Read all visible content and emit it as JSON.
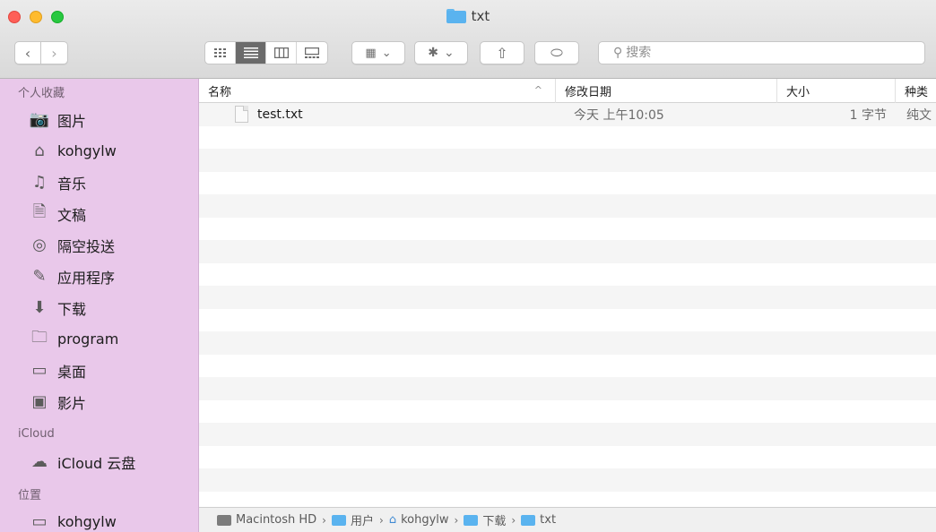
{
  "window": {
    "title": "txt"
  },
  "toolbar": {
    "back_icon": "‹",
    "forward_icon": "›",
    "view_modes": [
      "icon-view",
      "list-view",
      "column-view",
      "gallery-view"
    ],
    "arrange_icon": "▦",
    "action_icon": "✱",
    "chevron": "⌄",
    "share_icon": "⇧",
    "tag_icon": "⬭",
    "search_placeholder": "搜索",
    "search_glyph": "⚲"
  },
  "sidebar": {
    "favorites_header": "个人收藏",
    "favorites": [
      {
        "label": "图片",
        "icon": "📷"
      },
      {
        "label": "kohgylw",
        "icon": "⌂"
      },
      {
        "label": "音乐",
        "icon": "♫"
      },
      {
        "label": "文稿",
        "icon": "🗎"
      },
      {
        "label": "隔空投送",
        "icon": "◎"
      },
      {
        "label": "应用程序",
        "icon": "✎"
      },
      {
        "label": "下载",
        "icon": "⬇"
      },
      {
        "label": "program",
        "icon": "🗀"
      },
      {
        "label": "桌面",
        "icon": "▭"
      },
      {
        "label": "影片",
        "icon": "▣"
      }
    ],
    "icloud_header": "iCloud",
    "icloud": [
      {
        "label": "iCloud 云盘",
        "icon": "☁"
      }
    ],
    "locations_header": "位置",
    "locations": [
      {
        "label": "kohgylw",
        "icon": "▭"
      }
    ]
  },
  "columns": {
    "name": "名称",
    "date": "修改日期",
    "size": "大小",
    "kind": "种类",
    "sort_glyph": "^"
  },
  "files": [
    {
      "name": "test.txt",
      "date": "今天 上午10:05",
      "size": "1 字节",
      "kind": "纯文"
    }
  ],
  "pathbar": {
    "segments": [
      "Macintosh HD",
      "用户",
      "kohgylw",
      "下载",
      "txt"
    ],
    "separator": "›"
  },
  "colors": {
    "sidebar_bg": "#e9c8ea",
    "folder_blue": "#5ab3ef",
    "close": "#fe5f57",
    "minimize": "#febb2e",
    "zoom": "#28c840"
  }
}
